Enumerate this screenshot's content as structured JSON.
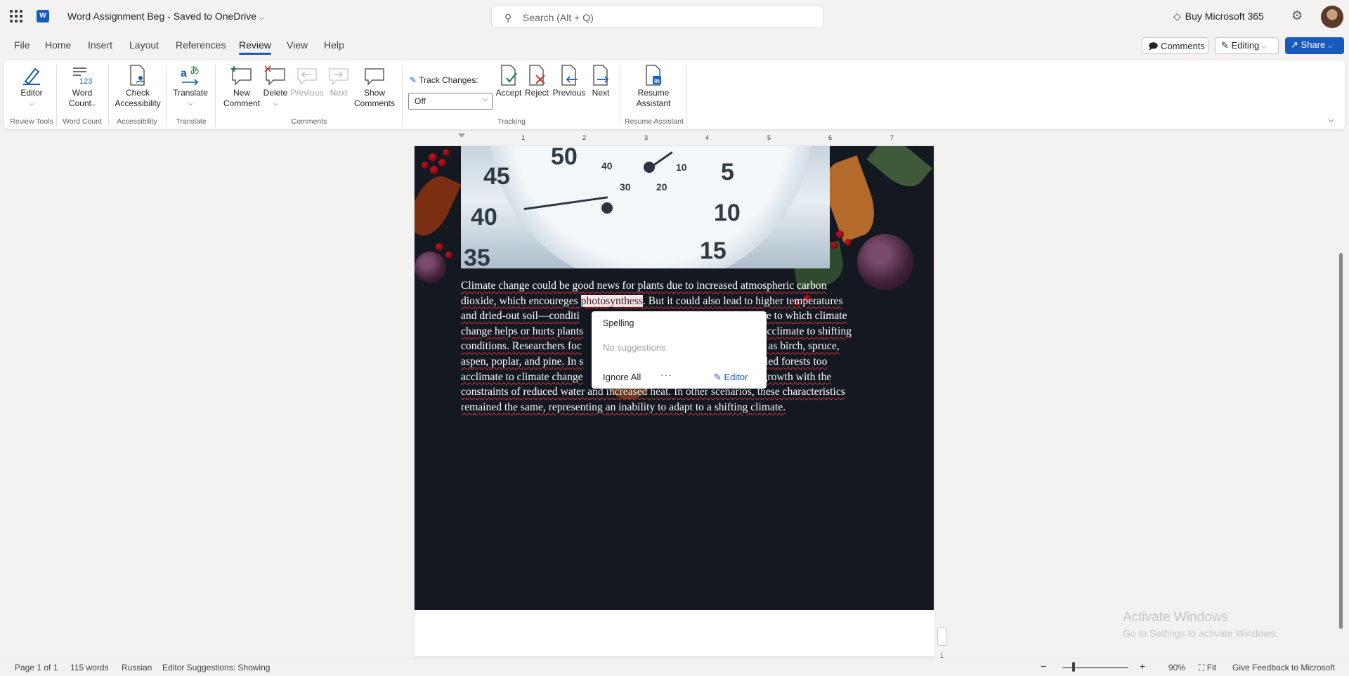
{
  "titlebar": {
    "doc_title": "Word Assignment Beg  -  Saved to OneDrive",
    "search_placeholder": "Search (Alt + Q)",
    "buy": "Buy Microsoft 365"
  },
  "menu": {
    "tabs": [
      "File",
      "Home",
      "Insert",
      "Layout",
      "References",
      "Review",
      "View",
      "Help"
    ],
    "active_tab": "Review",
    "comments_btn": "Comments",
    "editing_btn": "Editing",
    "share_btn": "Share"
  },
  "ribbon": {
    "editor": "Editor",
    "word_count_1": "Word",
    "word_count_2": "Count",
    "check_1": "Check",
    "check_2": "Accessibility",
    "translate": "Translate",
    "new_comment_1": "New",
    "new_comment_2": "Comment",
    "delete": "Delete",
    "previous_comment": "Previous",
    "next_comment": "Next",
    "show_1": "Show",
    "show_2": "Comments",
    "track_changes_label": "Track Changes:",
    "track_changes_value": "Off",
    "accept": "Accept",
    "reject": "Reject",
    "previous_change": "Previous",
    "next_change": "Next",
    "resume_1": "Resume",
    "resume_2": "Assistant",
    "groups": {
      "review_tools": "Review Tools",
      "word_count": "Word Count",
      "accessibility": "Accessibility",
      "translate": "Translate",
      "comments": "Comments",
      "tracking": "Tracking",
      "resume_assistant": "Resume Assistant"
    }
  },
  "ruler_numbers": [
    "1",
    "2",
    "3",
    "4",
    "5",
    "6",
    "7"
  ],
  "image_dial_numbers": [
    "50",
    "45",
    "40",
    "35",
    "5",
    "10",
    "15",
    "40",
    "30",
    "20",
    "10"
  ],
  "document": {
    "lines": [
      "Climate change could be good news for plants due to increased atmospheric carbon",
      "dioxide, which encoureges ",
      "photosynthess",
      ". But it could also lead to higher temperatures",
      "and dried-out soil—conditi",
      "gree to which climate",
      "change helps or hurts plants",
      "can acclimate to shifting",
      "conditions. Researchers foc",
      "uch as birch, spruce,",
      "aspen, poplar, and pine. In s",
      "abled forests too",
      "acclimate to climate change",
      "growth with the",
      "constraints of reduced water and increased heat. In other scenarios, these characteristics",
      "remained the same, representing an inability to adapt to a shifting climate."
    ]
  },
  "spelling_popup": {
    "title": "Spelling",
    "no_suggestions": "No suggestions",
    "ignore_all": "Ignore All",
    "more": "···",
    "editor": "Editor"
  },
  "page_marker": "1",
  "watermark": {
    "line1": "Activate Windows",
    "line2": "Go to Settings to activate Windows."
  },
  "status": {
    "page": "Page 1 of 1",
    "words": "115 words",
    "language": "Russian",
    "suggestions": "Editor Suggestions: Showing",
    "zoom_out": "−",
    "zoom_in": "+",
    "zoom": "90%",
    "fit": "Fit",
    "feedback": "Give Feedback to Microsoft",
    "zoom_level": 0.9
  },
  "colors": {
    "accent": "#185abd",
    "spell_underline": "#d13438"
  }
}
